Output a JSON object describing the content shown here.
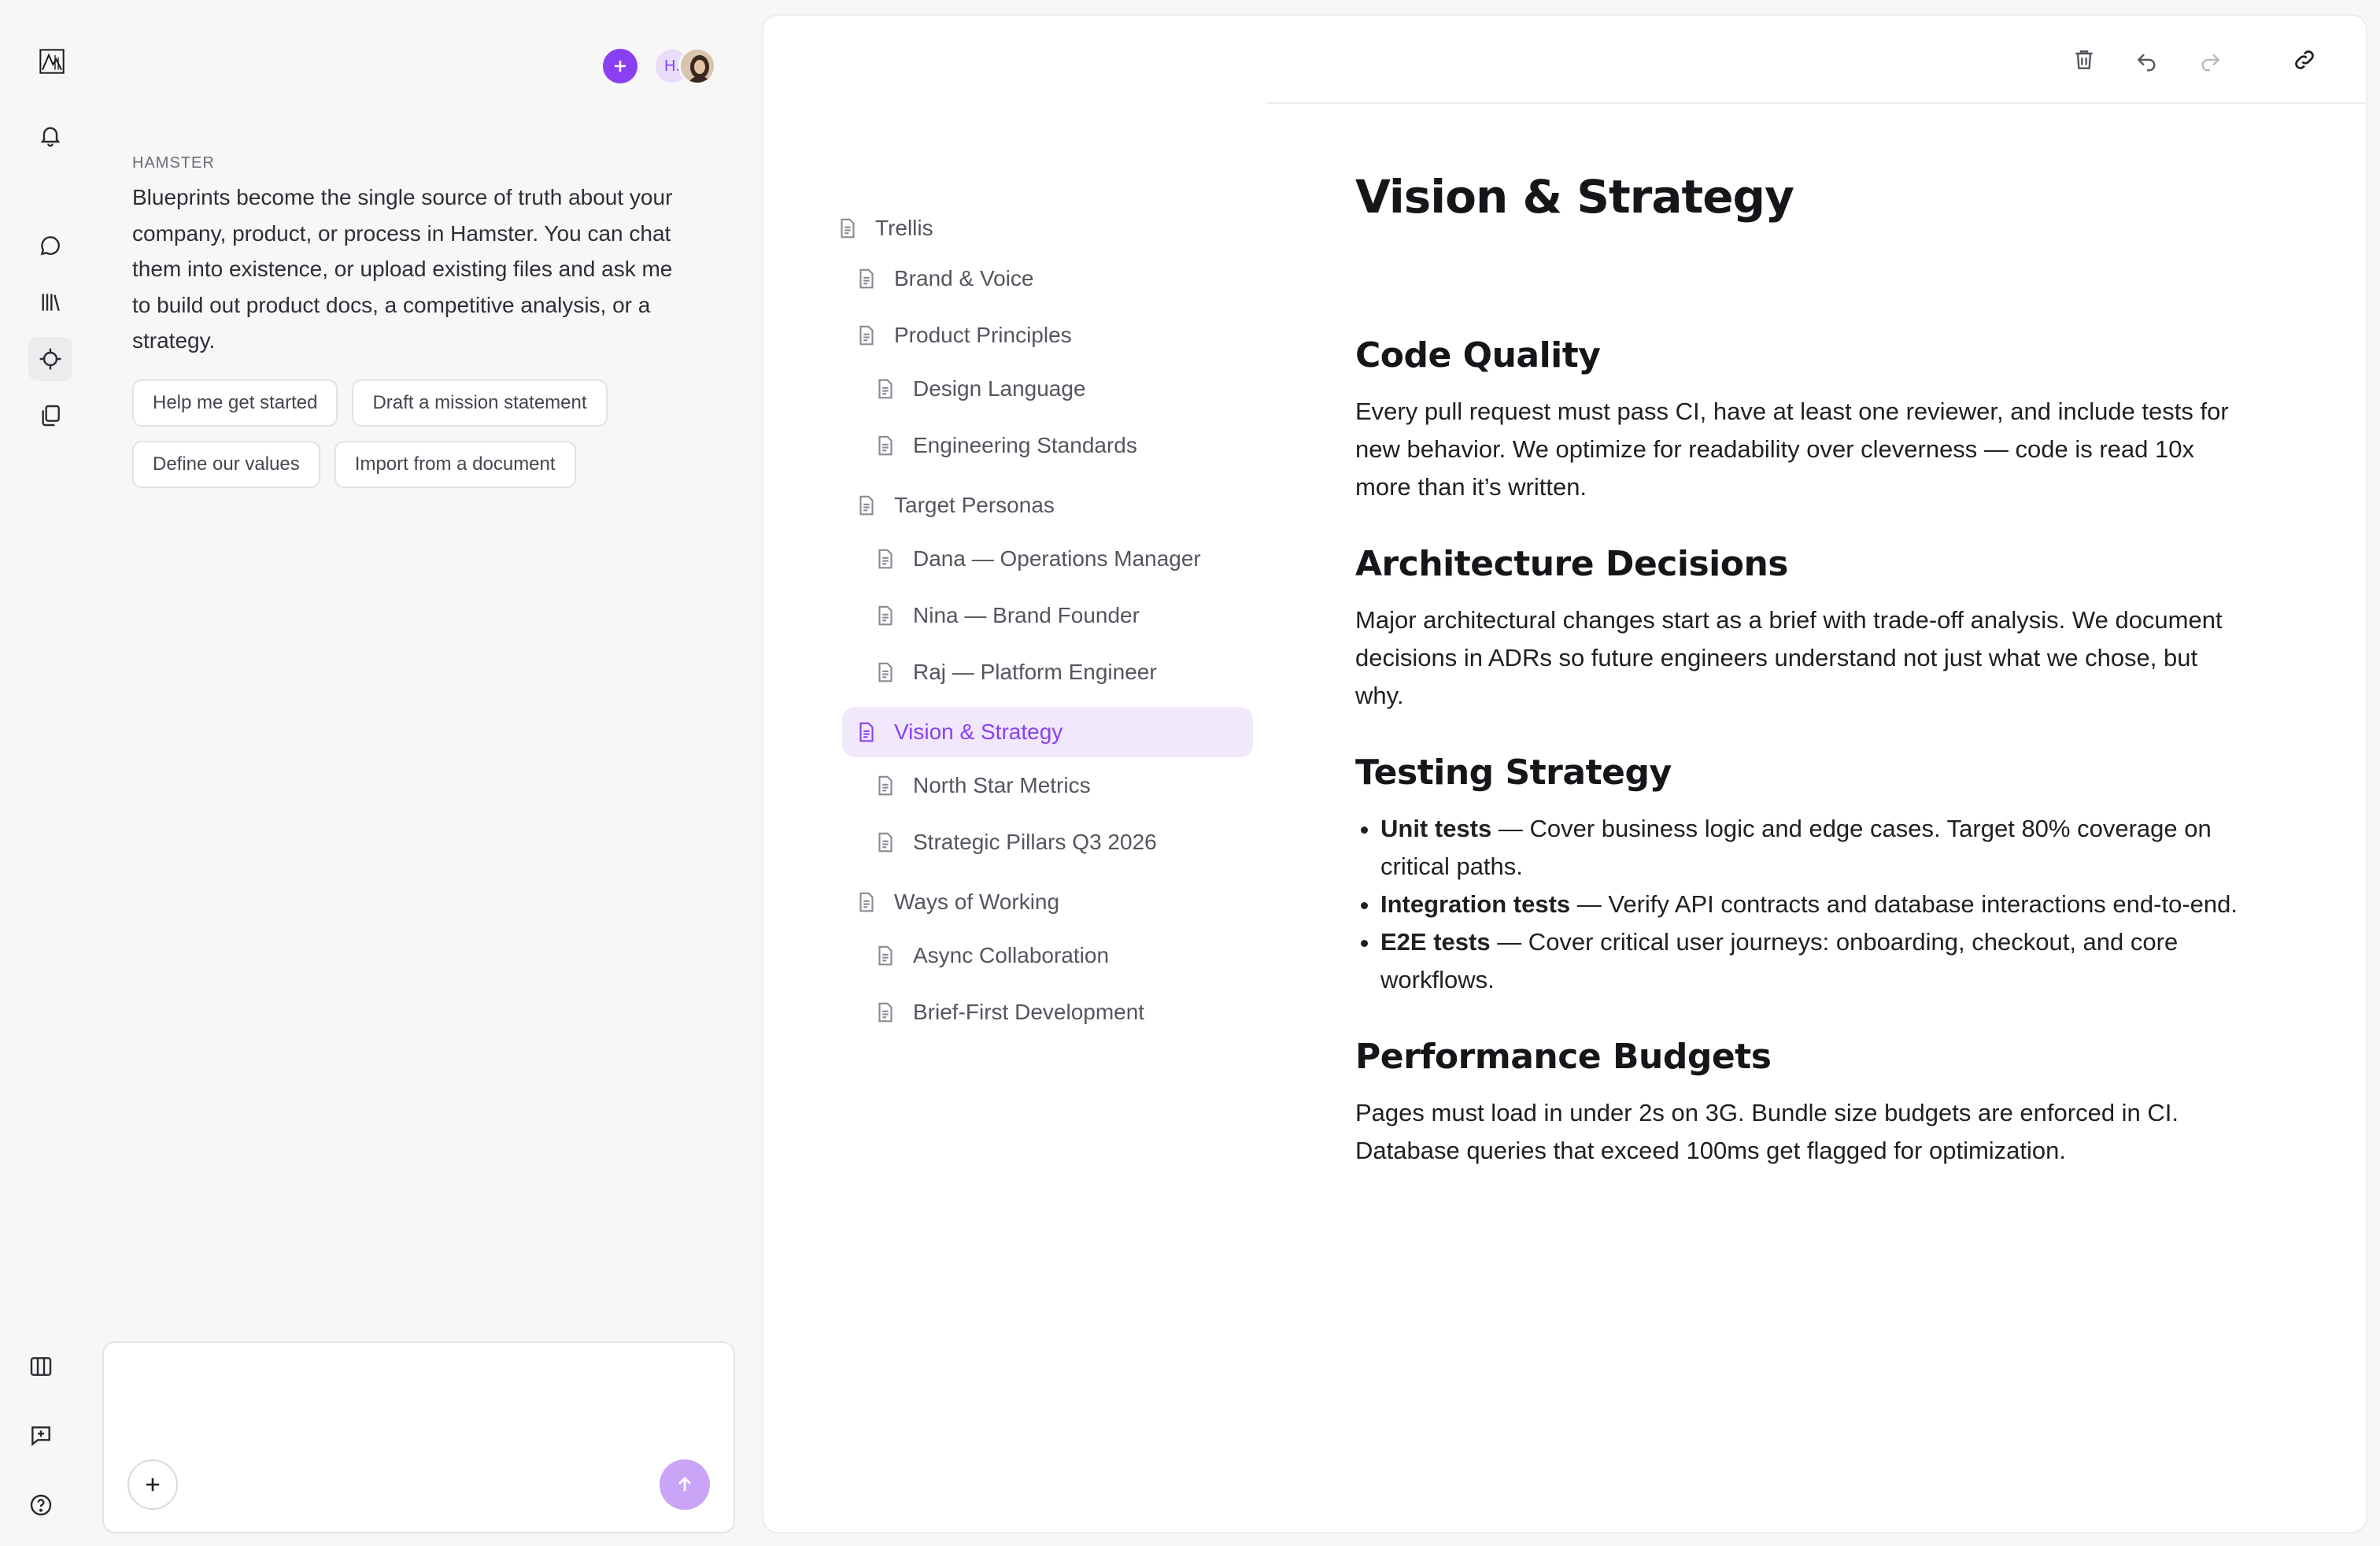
{
  "rail": {
    "logo": "logo-icon",
    "icons": [
      "bell-icon",
      "chat-icon",
      "library-icon",
      "crosshair-icon",
      "copy-icon"
    ],
    "bottom_icons": [
      "columns-icon",
      "new-message-icon",
      "help-icon"
    ]
  },
  "chat": {
    "avatar_initials": "H.",
    "sender": "HAMSTER",
    "message": "Blueprints become the single source of truth about your company, product, or process in Hamster. You can chat them into existence, or upload existing files and ask me to build out product docs, a competitive analysis, or a strategy.",
    "chips": [
      "Help me get started",
      "Draft a mission statement",
      "Define our values",
      "Import from a document"
    ],
    "composer_placeholder": ""
  },
  "toolbar": {
    "icons": [
      "trash-icon",
      "undo-icon",
      "redo-icon",
      "link-icon"
    ]
  },
  "tree": {
    "root": "Trellis",
    "brand_voice": "Brand & Voice",
    "product_principles": "Product Principles",
    "design_language": "Design Language",
    "engineering_standards": "Engineering Standards",
    "target_personas": "Target Personas",
    "persona_dana": "Dana — Operations Manager",
    "persona_nina": "Nina — Brand Founder",
    "persona_raj": "Raj — Platform Engineer",
    "vision_strategy": "Vision & Strategy",
    "north_star": "North Star Metrics",
    "pillars": "Strategic Pillars Q3 2026",
    "ways_of_working": "Ways of Working",
    "async": "Async Collaboration",
    "brief_first": "Brief-First Development"
  },
  "doc": {
    "title": "Vision & Strategy",
    "code_quality_h": "Code Quality",
    "code_quality_p": "Every pull request must pass CI, have at least one reviewer, and include tests for new behavior. We optimize for readability over cleverness — code is read 10x more than it’s written.",
    "arch_h": "Architecture Decisions",
    "arch_p": "Major architectural changes start as a brief with trade-off analysis. We document decisions in ADRs so future engineers understand not just what we chose, but why.",
    "testing_h": "Testing Strategy",
    "unit_label": "Unit tests",
    "unit_text": " — Cover business logic and edge cases. Target 80% coverage on critical paths.",
    "integration_label": "Integration tests",
    "integration_text": " — Verify API contracts and database interactions end-to-end.",
    "e2e_label": "E2E tests",
    "e2e_text": " — Cover critical user journeys: onboarding, checkout, and core workflows.",
    "perf_h": "Performance Budgets",
    "perf_p": "Pages must load in under 2s on 3G. Bundle size budgets are enforced in CI. Database queries that exceed 100ms get flagged for optimization."
  },
  "colors": {
    "accent": "#8b3ff2",
    "accent_light": "#f1e8fe",
    "send_button": "#c9a4f7"
  }
}
